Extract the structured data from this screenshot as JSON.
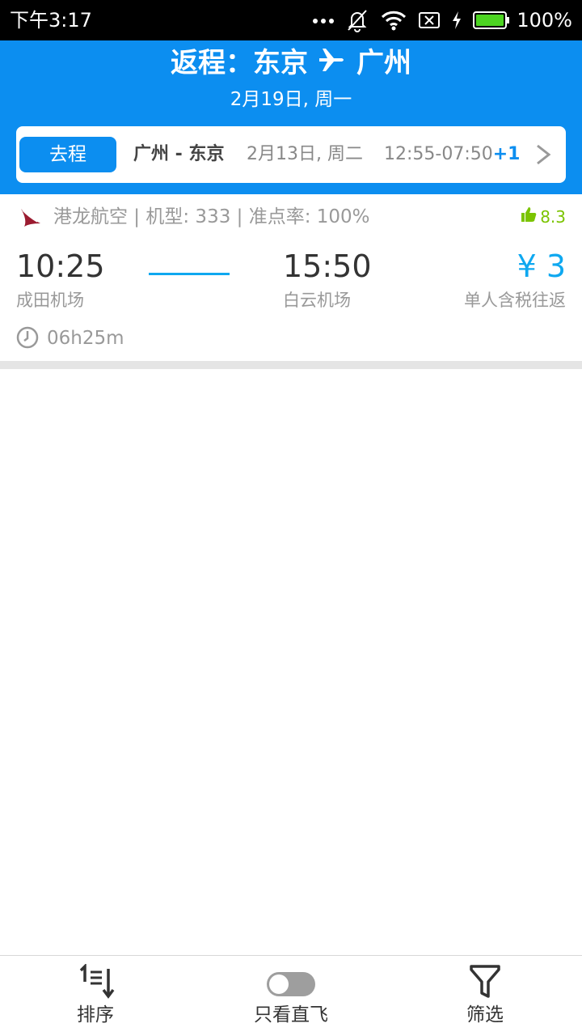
{
  "status_bar": {
    "time": "下午3:17",
    "battery": "100%",
    "icons": [
      "more-dots-icon",
      "mute-icon",
      "wifi-icon",
      "sim-x-icon",
      "charging-icon",
      "battery-icon"
    ]
  },
  "header": {
    "title_prefix": "返程：东京",
    "title_suffix": "广州",
    "date": "2月19日, 周一",
    "background_color": "#0c8ef0"
  },
  "outbound": {
    "badge": "去程",
    "route": "广州 - 东京",
    "date": "2月13日, 周二",
    "time": "12:55-07:50",
    "day_offset": "+1"
  },
  "flight": {
    "airline_info": "港龙航空 | 机型: 333 | 准点率: 100%",
    "rating": "8.3",
    "departure_time": "10:25",
    "departure_airport": "成田机场",
    "arrival_time": "15:50",
    "arrival_airport": "白云机场",
    "price": "¥ 3",
    "price_note": "单人含税往返",
    "duration": "06h25m"
  },
  "bottom_bar": {
    "sort_label": "排序",
    "direct_label": "只看直飞",
    "direct_enabled": false,
    "filter_label": "筛选"
  }
}
